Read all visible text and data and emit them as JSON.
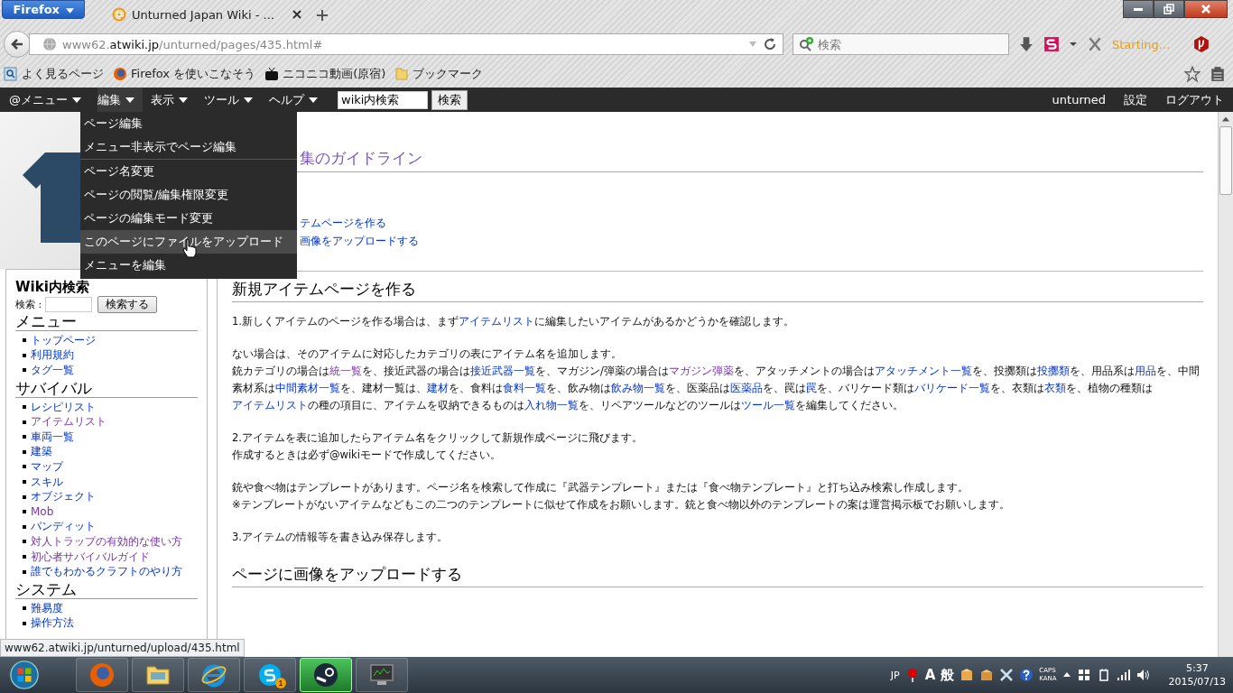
{
  "browser": {
    "menu_button": "Firefox",
    "tab_title": "Unturned Japan Wiki - ...",
    "address": {
      "prefix": "www62.",
      "domain": "atwiki.jp",
      "path": "/unturned/pages/435.html#"
    },
    "search": {
      "placeholder": "検索"
    },
    "addon_status": "Starting...",
    "bookmarks": [
      {
        "kind": "folder-search",
        "label": "よく見るページ"
      },
      {
        "kind": "firefox",
        "label": "Firefox を使いこなそう"
      },
      {
        "kind": "tv",
        "label": "ニコニコ動画(原宿)"
      },
      {
        "kind": "folder",
        "label": "ブックマーク"
      }
    ]
  },
  "wiki_bar": {
    "menus": [
      {
        "label": "@メニュー",
        "expanded": false
      },
      {
        "label": "編集",
        "expanded": true
      },
      {
        "label": "表示",
        "expanded": false
      },
      {
        "label": "ツール",
        "expanded": false
      },
      {
        "label": "ヘルプ",
        "expanded": false
      }
    ],
    "search": {
      "value": "wiki内検索"
    },
    "search_button": "検索",
    "user_links": [
      "unturned",
      "設定",
      "ログアウト"
    ]
  },
  "dropdown": {
    "groups": [
      [
        {
          "label": "ページ編集",
          "selected": false
        },
        {
          "label": "メニュー非表示でページ編集",
          "selected": false
        }
      ],
      [
        {
          "label": "ページ名変更",
          "selected": false
        },
        {
          "label": "ページの閲覧/編集権限変更",
          "selected": false
        },
        {
          "label": "ページの編集モード変更",
          "selected": false
        },
        {
          "label": "このページにファイルをアップロード",
          "selected": true
        },
        {
          "label": "メニューを編集",
          "selected": false
        }
      ]
    ]
  },
  "sidebar": {
    "search_title": "Wiki内検索",
    "search_label": "検索 :",
    "search_button": "検索する",
    "sections": [
      {
        "title": "メニュー",
        "items": [
          {
            "label": "トップページ",
            "visited": false
          },
          {
            "label": "利用規約",
            "visited": false
          },
          {
            "label": "タグ一覧",
            "visited": false
          }
        ]
      },
      {
        "title": "サバイバル",
        "items": [
          {
            "label": "レシピリスト",
            "visited": false
          },
          {
            "label": "アイテムリスト",
            "visited": true
          },
          {
            "label": "車両一覧",
            "visited": false
          },
          {
            "label": "建築",
            "visited": false
          },
          {
            "label": "マップ",
            "visited": false
          },
          {
            "label": "スキル",
            "visited": false
          },
          {
            "label": "オブジェクト",
            "visited": false
          },
          {
            "label": "Mob",
            "visited": true
          },
          {
            "label": "バンディット",
            "visited": false
          },
          {
            "label": "対人トラップの有効的な使い方",
            "visited": true
          },
          {
            "label": "初心者サバイバルガイド",
            "visited": true
          },
          {
            "label": "誰でもわかるクラフトのやり方",
            "visited": false
          }
        ]
      },
      {
        "title": "システム",
        "items": [
          {
            "label": "難易度",
            "visited": false
          },
          {
            "label": "操作方法",
            "visited": false
          }
        ]
      }
    ]
  },
  "intro": {
    "title": "集のガイドライン",
    "links": [
      "テムページを作る",
      "画像をアップロードする"
    ]
  },
  "sections": [
    {
      "heading": "新規アイテムページを作る",
      "paragraphs": [
        [
          [
            {
              "text": "1.新しくアイテムのページを作る場合は、まず"
            },
            {
              "text": "アイテムリスト",
              "link": true,
              "visited": false
            },
            {
              "text": "に編集したいアイテムがあるかどうかを確認します。"
            }
          ]
        ],
        [
          [
            {
              "text": "ない場合は、そのアイテムに対応したカテゴリの表にアイテム名を追加します。"
            }
          ],
          [
            {
              "text": "銃カテゴリの場合は"
            },
            {
              "text": "統一覧",
              "link": true,
              "visited": true
            },
            {
              "text": "を、接近武器の場合は"
            },
            {
              "text": "接近武器一覧",
              "link": true,
              "visited": false
            },
            {
              "text": "を、マガジン/弾薬の場合は"
            },
            {
              "text": "マガジン弾薬",
              "link": true,
              "visited": true
            },
            {
              "text": "を、アタッチメントの場合は"
            },
            {
              "text": "アタッチメント一覧",
              "link": true,
              "visited": false
            },
            {
              "text": "を、投擲類は"
            },
            {
              "text": "投擲類",
              "link": true,
              "visited": false
            },
            {
              "text": "を、用品系は"
            },
            {
              "text": "用品",
              "link": true,
              "visited": false
            },
            {
              "text": "を、中間素材系は"
            },
            {
              "text": "中間素材一覧",
              "link": true,
              "visited": false
            },
            {
              "text": "を、建材一覧は、"
            },
            {
              "text": "建材",
              "link": true,
              "visited": false
            },
            {
              "text": "を、食料は"
            },
            {
              "text": "食料一覧",
              "link": true,
              "visited": false
            },
            {
              "text": "を、飲み物は"
            },
            {
              "text": "飲み物一覧",
              "link": true,
              "visited": false
            },
            {
              "text": "を、医薬品は"
            },
            {
              "text": "医薬品",
              "link": true,
              "visited": false
            },
            {
              "text": "を、罠は"
            },
            {
              "text": "罠",
              "link": true,
              "visited": false
            },
            {
              "text": "を、バリケード類は"
            },
            {
              "text": "バリケード一覧",
              "link": true,
              "visited": false
            },
            {
              "text": "を、衣類は"
            },
            {
              "text": "衣類",
              "link": true,
              "visited": false
            },
            {
              "text": "を、植物の種類は"
            },
            {
              "text": "アイテムリスト",
              "link": true,
              "visited": false
            },
            {
              "text": "の種の項目に、アイテムを収納できるものは"
            },
            {
              "text": "入れ物一覧",
              "link": true,
              "visited": false
            },
            {
              "text": "を、リペアツールなどのツールは"
            },
            {
              "text": "ツール一覧",
              "link": true,
              "visited": false
            },
            {
              "text": "を編集してください。"
            }
          ]
        ],
        [
          [
            {
              "text": "2.アイテムを表に追加したらアイテム名をクリックして新規作成ページに飛びます。"
            }
          ],
          [
            {
              "text": "作成するときは必ず@wikiモードで作成してください。"
            }
          ]
        ],
        [
          [
            {
              "text": "銃や食べ物はテンプレートがあります。ページ名を検索して作成に『武器テンプレート』または『食べ物テンプレート』と打ち込み検索し作成します。"
            }
          ],
          [
            {
              "text": "※テンプレートがないアイテムなどもこの二つのテンプレートに似せて作成をお願いします。銃と食べ物以外のテンプレートの案は運営掲示板でお願いします。"
            }
          ]
        ],
        [
          [
            {
              "text": "3.アイテムの情報等を書き込み保存します。"
            }
          ]
        ]
      ]
    },
    {
      "heading": "ページに画像をアップロードする"
    }
  ],
  "status_url": "www62.atwiki.jp/unturned/upload/435.html",
  "taskbar": {
    "apps": [
      {
        "kind": "firefox",
        "active": false
      },
      {
        "kind": "explorer",
        "active": false
      },
      {
        "kind": "ie",
        "active": false
      },
      {
        "kind": "skype",
        "active": false,
        "badge": "1"
      },
      {
        "kind": "steam",
        "active": true
      },
      {
        "kind": "monitor",
        "active": false
      }
    ],
    "language": "JP",
    "ime_mode": "A",
    "ime_kanji": "般",
    "caps": "CAPS",
    "kana": "KANA",
    "time": "5:37",
    "date": "2015/07/13"
  }
}
